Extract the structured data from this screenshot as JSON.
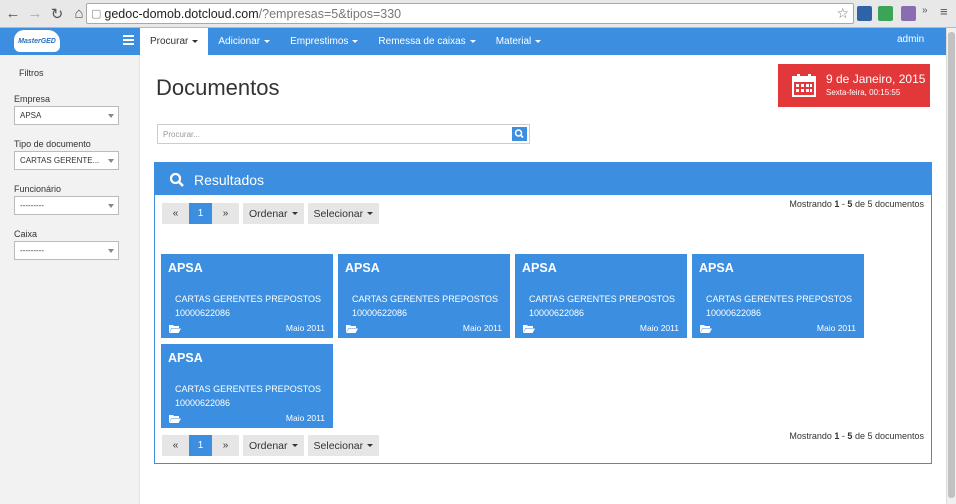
{
  "browser": {
    "url_host": "gedoc-domob.dotcloud.com",
    "url_path": "/?empresas=5&tipos=330"
  },
  "app": {
    "logo_text": "MasterGED",
    "user": "admin",
    "menu": [
      {
        "label": "Procurar",
        "active": true
      },
      {
        "label": "Adicionar"
      },
      {
        "label": "Emprestimos"
      },
      {
        "label": "Remessa de caixas"
      },
      {
        "label": "Material"
      }
    ]
  },
  "sidebar": {
    "title": "Filtros",
    "filters": [
      {
        "label": "Empresa",
        "value": "APSA"
      },
      {
        "label": "Tipo de documento",
        "value": "CARTAS GERENTE..."
      },
      {
        "label": "Funcionário",
        "value": "---------"
      },
      {
        "label": "Caixa",
        "value": "---------"
      }
    ]
  },
  "main": {
    "title": "Documentos",
    "date": {
      "main": "9 de Janeiro, 2015",
      "sub": "Sexta-feira, 00:15:55"
    },
    "search_placeholder": "Procurar...",
    "results_title": "Resultados",
    "pagination": {
      "prev": "«",
      "current": "1",
      "next": "»"
    },
    "order_label": "Ordenar",
    "select_label": "Selecionar",
    "showing": {
      "prefix": "Mostrando ",
      "from": "1",
      "sep": " - ",
      "to": "5",
      "mid": " de ",
      "total": "5",
      "suffix": " documentos"
    },
    "cards": [
      {
        "company": "APSA",
        "type": "CARTAS GERENTES PREPOSTOS",
        "code": "10000622086",
        "date": "Maio 2011"
      },
      {
        "company": "APSA",
        "type": "CARTAS GERENTES PREPOSTOS",
        "code": "10000622086",
        "date": "Maio 2011"
      },
      {
        "company": "APSA",
        "type": "CARTAS GERENTES PREPOSTOS",
        "code": "10000622086",
        "date": "Maio 2011"
      },
      {
        "company": "APSA",
        "type": "CARTAS GERENTES PREPOSTOS",
        "code": "10000622086",
        "date": "Maio 2011"
      },
      {
        "company": "APSA",
        "type": "CARTAS GERENTES PREPOSTOS",
        "code": "10000622086",
        "date": "Maio 2011"
      }
    ]
  },
  "colors": {
    "primary": "#3b8ee0",
    "date_box": "#e2383a"
  }
}
